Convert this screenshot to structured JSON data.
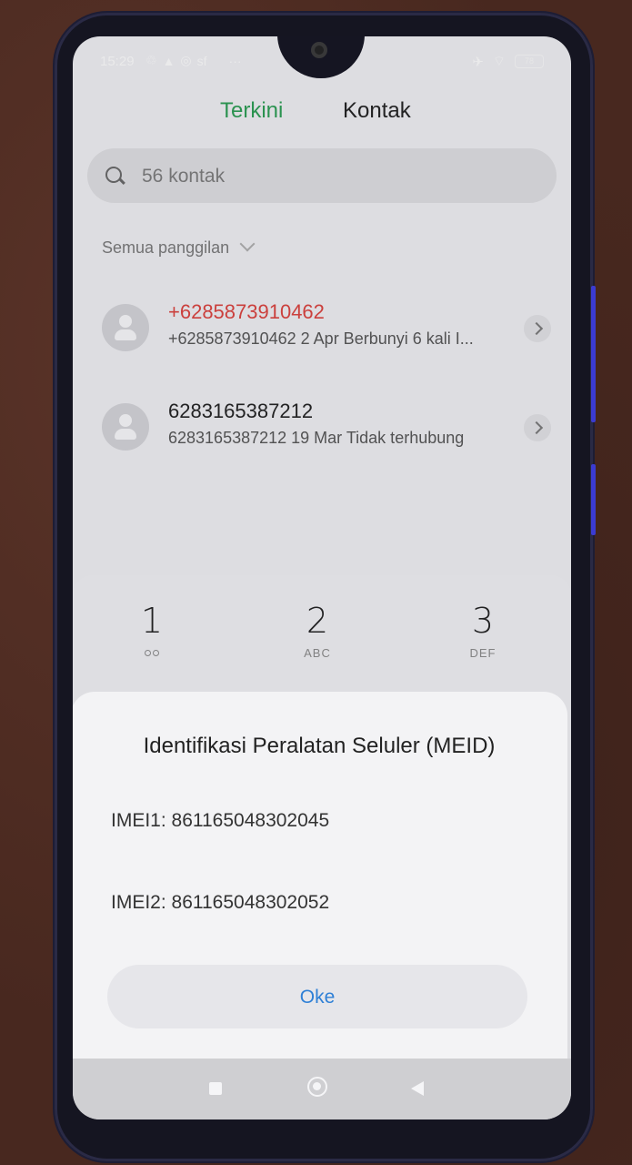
{
  "status_bar": {
    "time": "15:29",
    "left_icons": [
      "sync-icon",
      "warning-icon",
      "whatsapp-icon",
      "sf",
      "more-dots-icon"
    ],
    "left_icon_glyphs": [
      "♲",
      "▲",
      "◎",
      "sf",
      "···"
    ],
    "right_icons": [
      "airplane-icon",
      "wifi-icon",
      "battery-icon"
    ],
    "battery": "78"
  },
  "tabs": [
    {
      "label": "Terkini",
      "active": true
    },
    {
      "label": "Kontak",
      "active": false
    }
  ],
  "search": {
    "placeholder": "56 kontak"
  },
  "filter": {
    "label": "Semua panggilan"
  },
  "calls": [
    {
      "name": "+6285873910462",
      "detail": "+6285873910462  2 Apr Berbunyi 6 kali  I...",
      "missed": true
    },
    {
      "name": "6283165387212",
      "detail": "6283165387212  19 Mar Tidak terhubung",
      "missed": false
    }
  ],
  "dialpad": {
    "keys": [
      {
        "num": "1",
        "sub": ""
      },
      {
        "num": "2",
        "sub": "ABC"
      },
      {
        "num": "3",
        "sub": "DEF"
      }
    ]
  },
  "dialog": {
    "title": "Identifikasi Peralatan Seluler (MEID)",
    "imei1": "IMEI1: 861165048302045",
    "imei2": "IMEI2: 861165048302052",
    "ok_label": "Oke"
  },
  "colors": {
    "accent_green": "#2c9a52",
    "missed_red": "#d6423e",
    "link_blue": "#2f80d6"
  }
}
